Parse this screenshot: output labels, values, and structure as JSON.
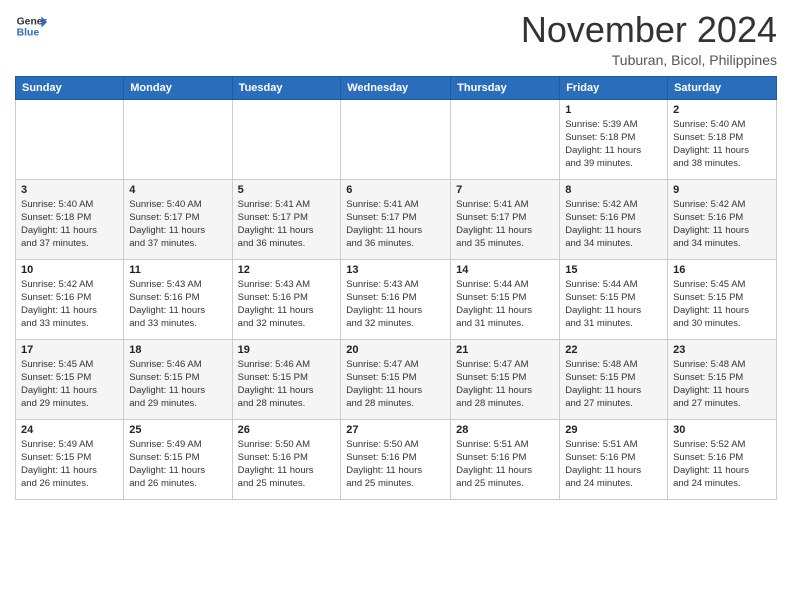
{
  "logo": {
    "line1": "General",
    "line2": "Blue"
  },
  "title": "November 2024",
  "location": "Tuburan, Bicol, Philippines",
  "days_of_week": [
    "Sunday",
    "Monday",
    "Tuesday",
    "Wednesday",
    "Thursday",
    "Friday",
    "Saturday"
  ],
  "weeks": [
    [
      {
        "day": "",
        "info": ""
      },
      {
        "day": "",
        "info": ""
      },
      {
        "day": "",
        "info": ""
      },
      {
        "day": "",
        "info": ""
      },
      {
        "day": "",
        "info": ""
      },
      {
        "day": "1",
        "info": "Sunrise: 5:39 AM\nSunset: 5:18 PM\nDaylight: 11 hours\nand 39 minutes."
      },
      {
        "day": "2",
        "info": "Sunrise: 5:40 AM\nSunset: 5:18 PM\nDaylight: 11 hours\nand 38 minutes."
      }
    ],
    [
      {
        "day": "3",
        "info": "Sunrise: 5:40 AM\nSunset: 5:18 PM\nDaylight: 11 hours\nand 37 minutes."
      },
      {
        "day": "4",
        "info": "Sunrise: 5:40 AM\nSunset: 5:17 PM\nDaylight: 11 hours\nand 37 minutes."
      },
      {
        "day": "5",
        "info": "Sunrise: 5:41 AM\nSunset: 5:17 PM\nDaylight: 11 hours\nand 36 minutes."
      },
      {
        "day": "6",
        "info": "Sunrise: 5:41 AM\nSunset: 5:17 PM\nDaylight: 11 hours\nand 36 minutes."
      },
      {
        "day": "7",
        "info": "Sunrise: 5:41 AM\nSunset: 5:17 PM\nDaylight: 11 hours\nand 35 minutes."
      },
      {
        "day": "8",
        "info": "Sunrise: 5:42 AM\nSunset: 5:16 PM\nDaylight: 11 hours\nand 34 minutes."
      },
      {
        "day": "9",
        "info": "Sunrise: 5:42 AM\nSunset: 5:16 PM\nDaylight: 11 hours\nand 34 minutes."
      }
    ],
    [
      {
        "day": "10",
        "info": "Sunrise: 5:42 AM\nSunset: 5:16 PM\nDaylight: 11 hours\nand 33 minutes."
      },
      {
        "day": "11",
        "info": "Sunrise: 5:43 AM\nSunset: 5:16 PM\nDaylight: 11 hours\nand 33 minutes."
      },
      {
        "day": "12",
        "info": "Sunrise: 5:43 AM\nSunset: 5:16 PM\nDaylight: 11 hours\nand 32 minutes."
      },
      {
        "day": "13",
        "info": "Sunrise: 5:43 AM\nSunset: 5:16 PM\nDaylight: 11 hours\nand 32 minutes."
      },
      {
        "day": "14",
        "info": "Sunrise: 5:44 AM\nSunset: 5:15 PM\nDaylight: 11 hours\nand 31 minutes."
      },
      {
        "day": "15",
        "info": "Sunrise: 5:44 AM\nSunset: 5:15 PM\nDaylight: 11 hours\nand 31 minutes."
      },
      {
        "day": "16",
        "info": "Sunrise: 5:45 AM\nSunset: 5:15 PM\nDaylight: 11 hours\nand 30 minutes."
      }
    ],
    [
      {
        "day": "17",
        "info": "Sunrise: 5:45 AM\nSunset: 5:15 PM\nDaylight: 11 hours\nand 29 minutes."
      },
      {
        "day": "18",
        "info": "Sunrise: 5:46 AM\nSunset: 5:15 PM\nDaylight: 11 hours\nand 29 minutes."
      },
      {
        "day": "19",
        "info": "Sunrise: 5:46 AM\nSunset: 5:15 PM\nDaylight: 11 hours\nand 28 minutes."
      },
      {
        "day": "20",
        "info": "Sunrise: 5:47 AM\nSunset: 5:15 PM\nDaylight: 11 hours\nand 28 minutes."
      },
      {
        "day": "21",
        "info": "Sunrise: 5:47 AM\nSunset: 5:15 PM\nDaylight: 11 hours\nand 28 minutes."
      },
      {
        "day": "22",
        "info": "Sunrise: 5:48 AM\nSunset: 5:15 PM\nDaylight: 11 hours\nand 27 minutes."
      },
      {
        "day": "23",
        "info": "Sunrise: 5:48 AM\nSunset: 5:15 PM\nDaylight: 11 hours\nand 27 minutes."
      }
    ],
    [
      {
        "day": "24",
        "info": "Sunrise: 5:49 AM\nSunset: 5:15 PM\nDaylight: 11 hours\nand 26 minutes."
      },
      {
        "day": "25",
        "info": "Sunrise: 5:49 AM\nSunset: 5:15 PM\nDaylight: 11 hours\nand 26 minutes."
      },
      {
        "day": "26",
        "info": "Sunrise: 5:50 AM\nSunset: 5:16 PM\nDaylight: 11 hours\nand 25 minutes."
      },
      {
        "day": "27",
        "info": "Sunrise: 5:50 AM\nSunset: 5:16 PM\nDaylight: 11 hours\nand 25 minutes."
      },
      {
        "day": "28",
        "info": "Sunrise: 5:51 AM\nSunset: 5:16 PM\nDaylight: 11 hours\nand 25 minutes."
      },
      {
        "day": "29",
        "info": "Sunrise: 5:51 AM\nSunset: 5:16 PM\nDaylight: 11 hours\nand 24 minutes."
      },
      {
        "day": "30",
        "info": "Sunrise: 5:52 AM\nSunset: 5:16 PM\nDaylight: 11 hours\nand 24 minutes."
      }
    ]
  ]
}
